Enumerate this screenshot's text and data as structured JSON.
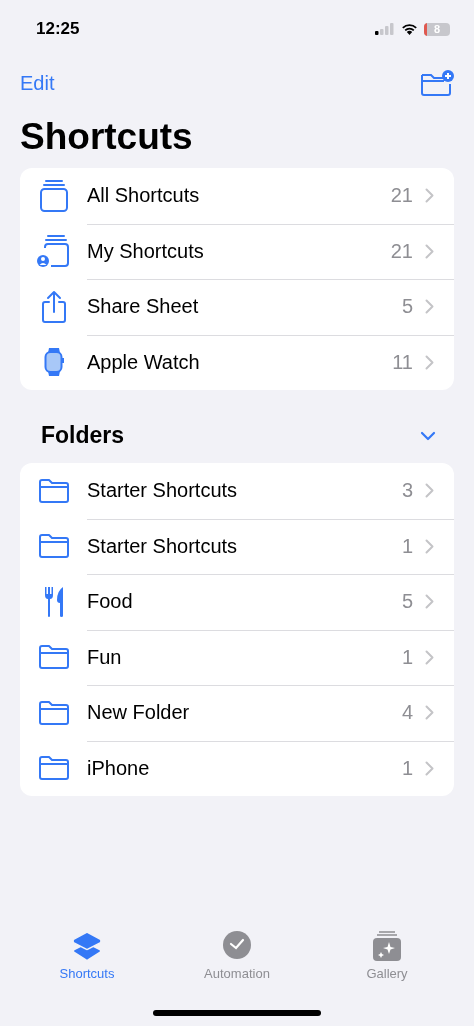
{
  "status_bar": {
    "time": "12:25",
    "battery": "8"
  },
  "nav": {
    "edit": "Edit"
  },
  "title": "Shortcuts",
  "library": [
    {
      "kind": "all",
      "label": "All Shortcuts",
      "count": "21"
    },
    {
      "kind": "mine",
      "label": "My Shortcuts",
      "count": "21"
    },
    {
      "kind": "share",
      "label": "Share Sheet",
      "count": "5"
    },
    {
      "kind": "watch",
      "label": "Apple Watch",
      "count": "11"
    }
  ],
  "folders": {
    "title": "Folders",
    "expanded": true,
    "items": [
      {
        "kind": "folder",
        "label": "Starter Shortcuts",
        "count": "3"
      },
      {
        "kind": "folder",
        "label": "Starter Shortcuts",
        "count": "1"
      },
      {
        "kind": "food",
        "label": "Food",
        "count": "5"
      },
      {
        "kind": "folder",
        "label": "Fun",
        "count": "1"
      },
      {
        "kind": "folder",
        "label": "New Folder",
        "count": "4"
      },
      {
        "kind": "folder",
        "label": "iPhone",
        "count": "1"
      }
    ]
  },
  "tabs": [
    {
      "kind": "shortcuts",
      "label": "Shortcuts",
      "selected": true
    },
    {
      "kind": "automation",
      "label": "Automation",
      "selected": false
    },
    {
      "kind": "gallery",
      "label": "Gallery",
      "selected": false
    }
  ]
}
